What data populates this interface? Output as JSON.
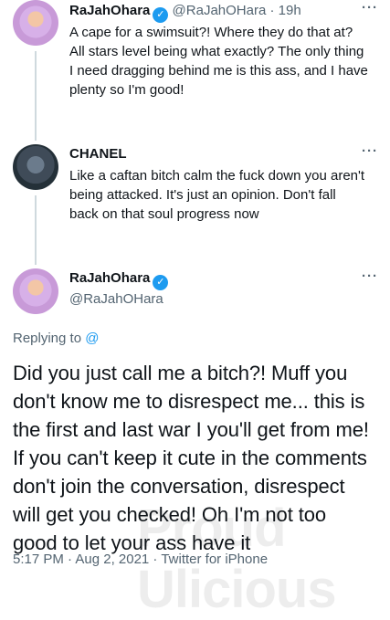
{
  "tweet1": {
    "name": "RaJahOhara",
    "handle": "@RaJahOHara",
    "sep": "·",
    "time": "19h",
    "line1": "A cape for a swimsuit?! Where they do that at?",
    "line2": "All stars level being what exactly? The only thing",
    "line3": "I need dragging behind me is this ass, and I have",
    "line4": "plenty so I'm good!"
  },
  "tweet2": {
    "name": "CHANEL",
    "line1": "Like a caftan bitch calm the fuck down you aren't",
    "line2": "being attacked. It's just an opinion. Don't fall",
    "line3": "back on that soul progress now"
  },
  "main": {
    "name": "RaJahOhara",
    "handle": "@RaJahOHara",
    "replying_prefix": "Replying to",
    "replying_at": "@",
    "line1": "Did you just call me a bitch?! Muff you",
    "line2": "don't know me to disrespect me... this is",
    "line3": "the first and last war I you'll get from me!",
    "line4": "If you can't keep it cute in the comments",
    "line5": "don't join the conversation, disrespect",
    "line6": "will get you checked! Oh I'm not too",
    "line7": "good to let your ass have it",
    "meta": "5:17 PM · Aug 2, 2021 · Twitter for iPhone"
  },
  "watermark": "Proud Ulicious",
  "icons": {
    "verified": "verified-badge-icon",
    "more": "more-icon"
  }
}
